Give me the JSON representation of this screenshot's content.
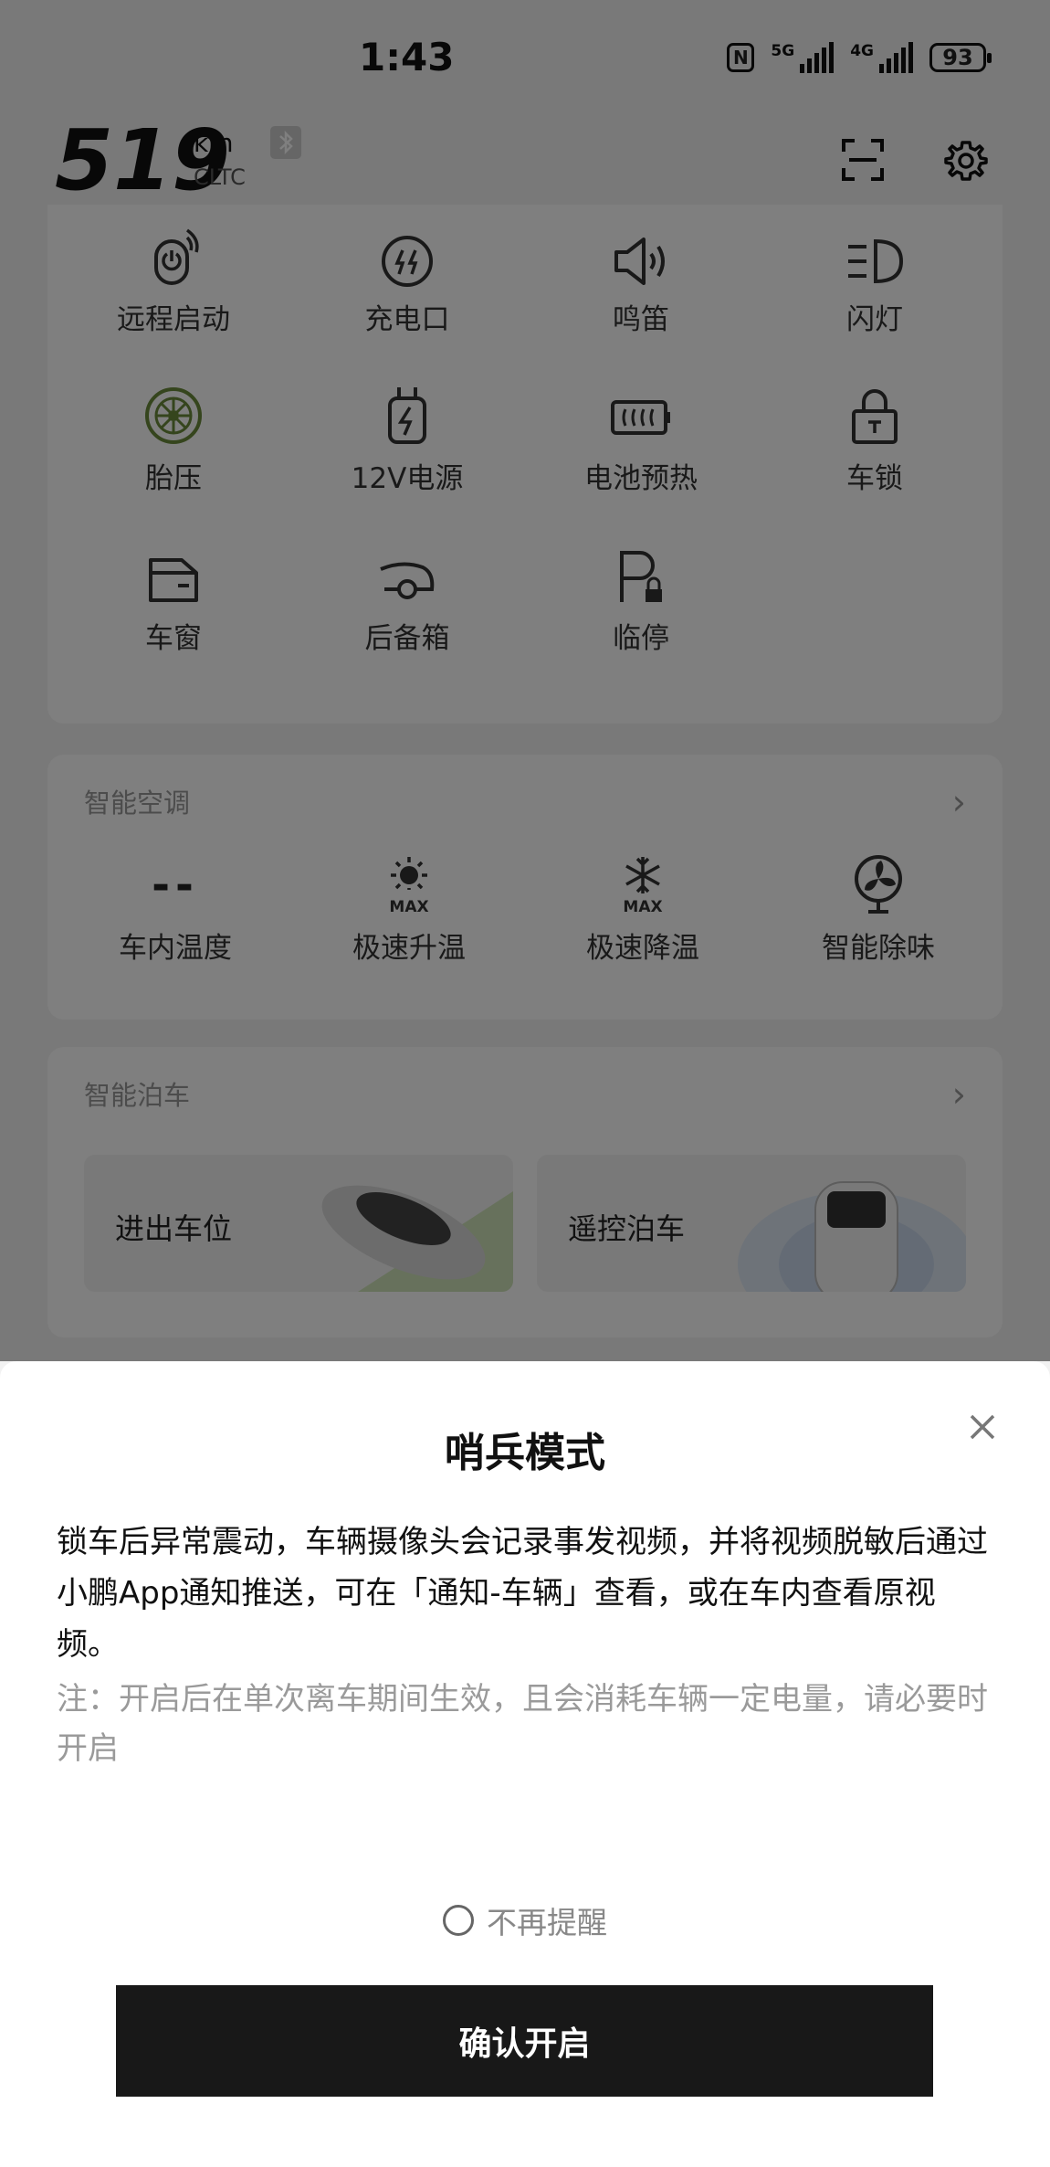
{
  "status_bar": {
    "time": "1:43",
    "battery": "93",
    "nfc": "N",
    "sim1": "5G",
    "sim2": "4G"
  },
  "header": {
    "range_value": "519",
    "range_unit": "km",
    "range_standard": "CLTC"
  },
  "controls": {
    "items": [
      "远程启动",
      "充电口",
      "鸣笛",
      "闪灯",
      "胎压",
      "12V电源",
      "电池预热",
      "车锁",
      "车窗",
      "后备箱",
      "临停"
    ]
  },
  "climate": {
    "title": "智能空调",
    "temp_value": "--",
    "items": [
      "车内温度",
      "极速升温",
      "极速降温",
      "智能除味"
    ],
    "max_label": "MAX"
  },
  "parking": {
    "title": "智能泊车",
    "items": [
      "进出车位",
      "遥控泊车"
    ]
  },
  "dialog": {
    "title": "哨兵模式",
    "description": "锁车后异常震动，车辆摄像头会记录事发视频，并将视频脱敏后通过小鹏App通知推送，可在「通知-车辆」查看，或在车内查看原视频。",
    "note": "注：开启后在单次离车期间生效，且会消耗车辆一定电量，请必要时开启",
    "dont_remind": "不再提醒",
    "confirm": "确认开启"
  },
  "colors": {
    "overlay": "rgba(0,0,0,0.5)",
    "button_bg": "#181818",
    "tire_green": "#6a8a3a"
  }
}
